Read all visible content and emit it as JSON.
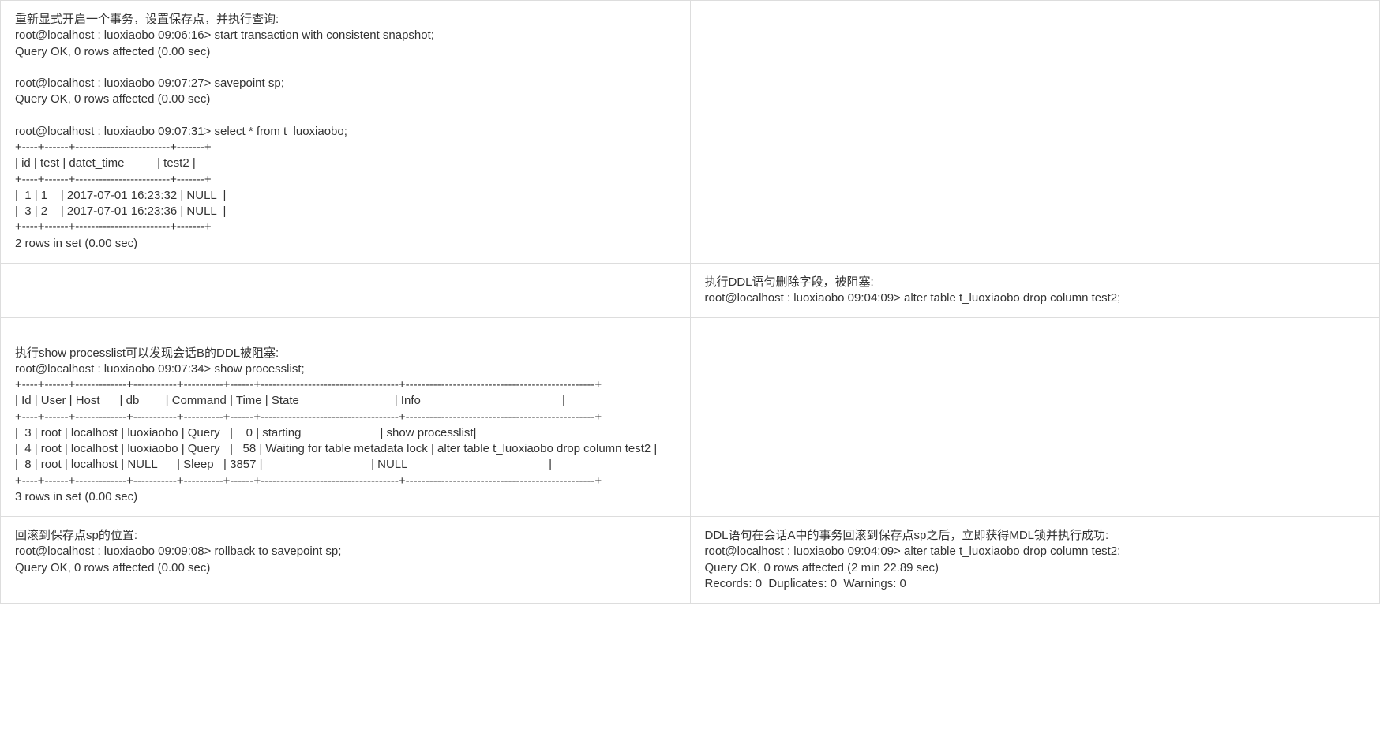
{
  "rows": [
    {
      "left": "重新显式开启一个事务，设置保存点，并执行查询:\nroot@localhost : luoxiaobo 09:06:16> start transaction with consistent snapshot;\nQuery OK, 0 rows affected (0.00 sec)\n\nroot@localhost : luoxiaobo 09:07:27> savepoint sp;\nQuery OK, 0 rows affected (0.00 sec)\n\nroot@localhost : luoxiaobo 09:07:31> select * from t_luoxiaobo;\n+----+------+------------------------+-------+\n| id | test | datet_time          | test2 |\n+----+------+------------------------+-------+\n|  1 | 1    | 2017-07-01 16:23:32 | NULL  |\n|  3 | 2    | 2017-07-01 16:23:36 | NULL  |\n+----+------+------------------------+-------+\n2 rows in set (0.00 sec)",
      "right": ""
    },
    {
      "left": "",
      "right": "执行DDL语句删除字段，被阻塞:\nroot@localhost : luoxiaobo 09:04:09> alter table t_luoxiaobo drop column test2;"
    },
    {
      "left": "\n执行show processlist可以发现会话B的DDL被阻塞:\nroot@localhost : luoxiaobo 09:07:34> show processlist;\n+----+------+-------------+-----------+----------+------+-----------------------------------+------------------------------------------------+\n| Id | User | Host      | db        | Command | Time | State                             | Info                                           |\n+----+------+-------------+-----------+----------+------+-----------------------------------+------------------------------------------------+\n|  3 | root | localhost | luoxiaobo | Query   |    0 | starting                        | show processlist|\n|  4 | root | localhost | luoxiaobo | Query   |   58 | Waiting for table metadata lock | alter table t_luoxiaobo drop column test2 |\n|  8 | root | localhost | NULL      | Sleep   | 3857 |                                 | NULL                                           |\n+----+------+-------------+-----------+----------+------+-----------------------------------+------------------------------------------------+\n3 rows in set (0.00 sec)\n",
      "right": ""
    },
    {
      "left": "回滚到保存点sp的位置:\nroot@localhost : luoxiaobo 09:09:08> rollback to savepoint sp;\nQuery OK, 0 rows affected (0.00 sec)",
      "right": "DDL语句在会话A中的事务回滚到保存点sp之后，立即获得MDL锁并执行成功:\nroot@localhost : luoxiaobo 09:04:09> alter table t_luoxiaobo drop column test2;\nQuery OK, 0 rows affected (2 min 22.89 sec)\nRecords: 0  Duplicates: 0  Warnings: 0"
    }
  ]
}
